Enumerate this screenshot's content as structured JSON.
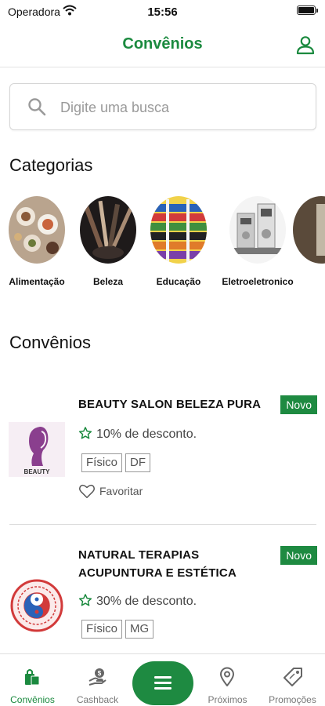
{
  "status_bar": {
    "carrier": "Operadora",
    "time": "15:56",
    "battery_level": 1.0
  },
  "header": {
    "title": "Convênios",
    "profile_icon": "user-icon"
  },
  "search": {
    "placeholder": "Digite uma busca",
    "icon": "search-icon"
  },
  "categories": {
    "title": "Categorias",
    "items": [
      {
        "label": "Alimentação"
      },
      {
        "label": "Beleza"
      },
      {
        "label": "Educação"
      },
      {
        "label": "Eletroeletronico"
      }
    ]
  },
  "listings": {
    "title": "Convênios",
    "items": [
      {
        "name": "BEAUTY SALON BELEZA PURA",
        "badge": "Novo",
        "discount": "10% de desconto.",
        "tags": [
          "Físico",
          "DF"
        ],
        "favorite_label": "Favoritar",
        "logo_text": "BEAUTY"
      },
      {
        "name": "NATURAL TERAPIAS ACUPUNTURA E ESTÉTICA",
        "badge": "Novo",
        "discount": "30% de desconto.",
        "tags": [
          "Físico",
          "MG"
        ]
      }
    ]
  },
  "bottom_nav": {
    "items": [
      {
        "label": "Convênios",
        "icon": "shopping-bags-icon",
        "active": true
      },
      {
        "label": "Cashback",
        "icon": "hand-coin-icon",
        "active": false
      },
      {
        "label": "",
        "icon": "menu-icon",
        "active": false
      },
      {
        "label": "Próximos",
        "icon": "map-pin-icon",
        "active": false
      },
      {
        "label": "Promoções",
        "icon": "price-tag-icon",
        "active": false
      }
    ]
  },
  "colors": {
    "primary": "#1b8a3f",
    "badge": "#1e8a41",
    "text": "#111111",
    "muted": "#777777"
  }
}
